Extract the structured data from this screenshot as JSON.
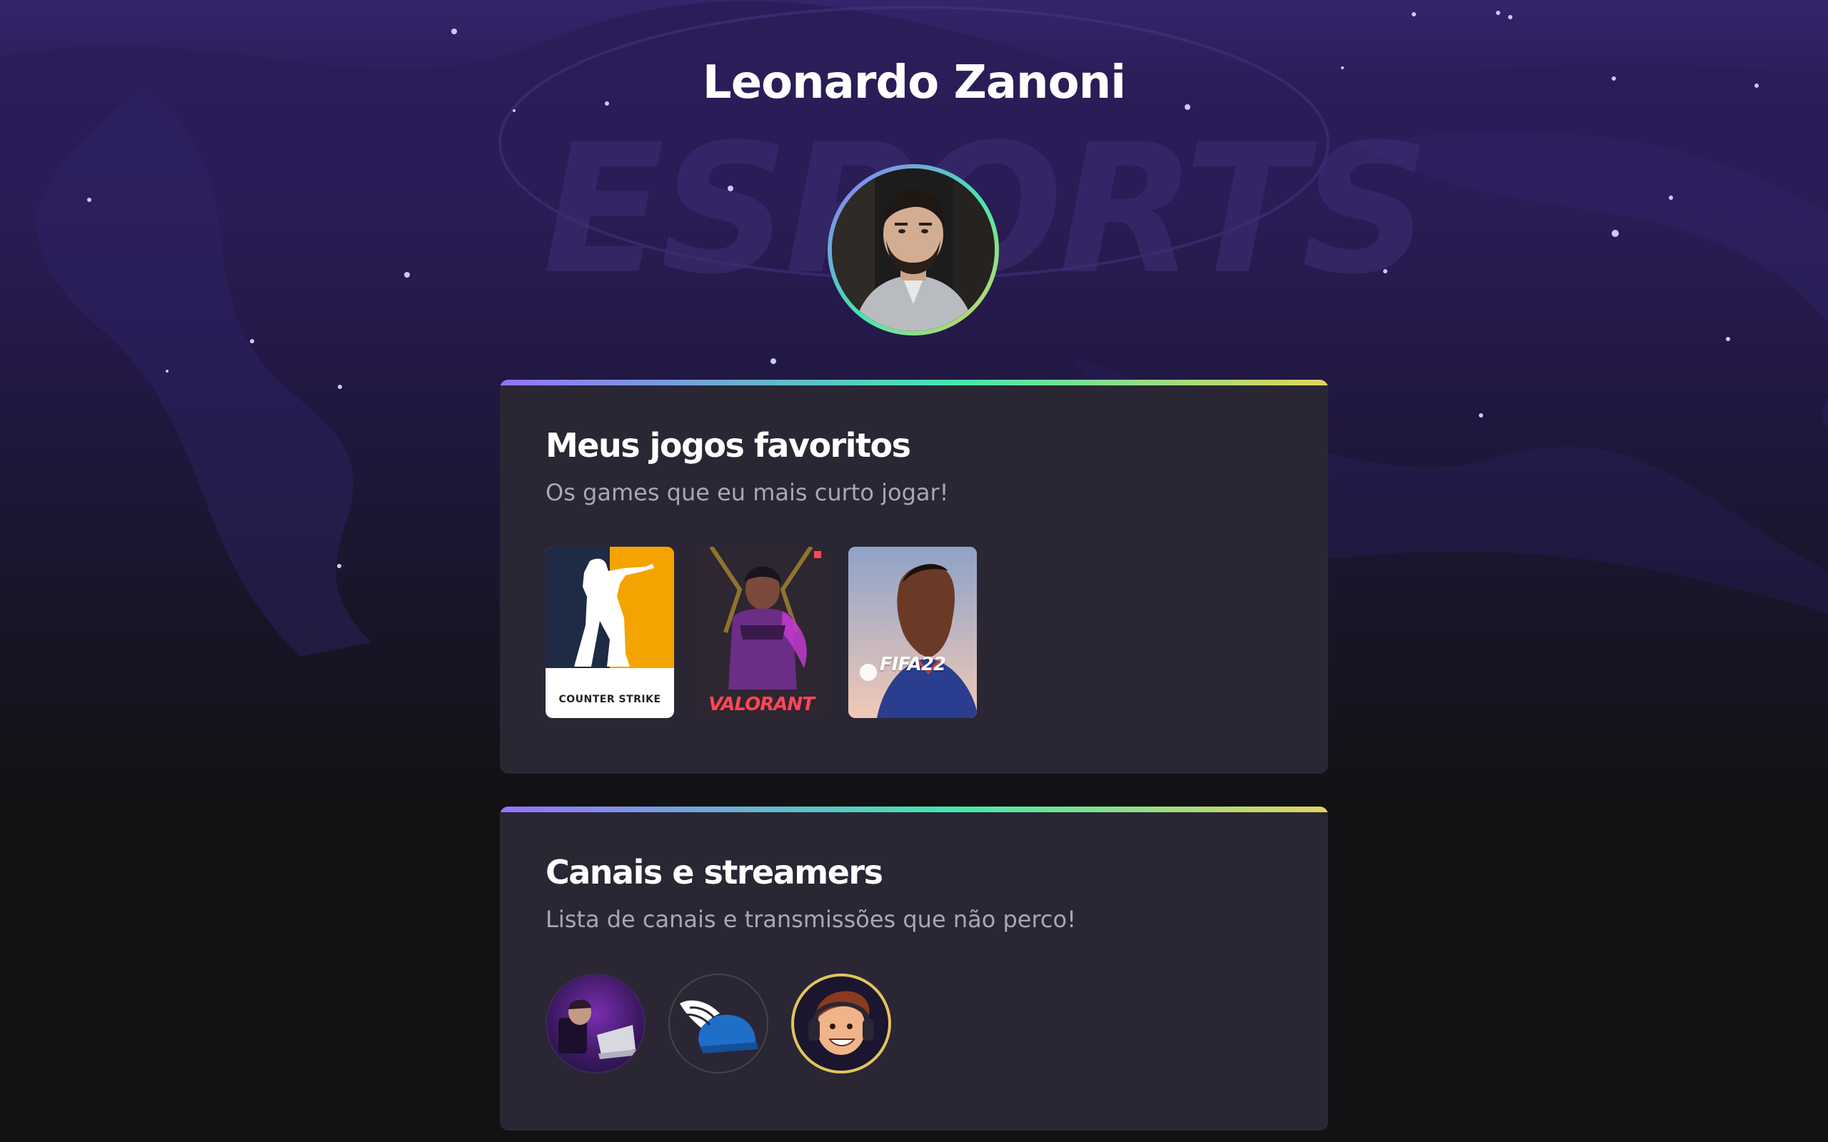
{
  "profile": {
    "name": "Leonardo Zanoni",
    "avatar_alt": "Leonardo Zanoni"
  },
  "games_section": {
    "title": "Meus jogos favoritos",
    "subtitle": "Os games que eu mais curto jogar!",
    "games": [
      {
        "name": "COUNTER STRIKE",
        "icon": "counter-strike-cover"
      },
      {
        "name": "VALORANT",
        "icon": "valorant-cover"
      },
      {
        "name": "FIFA22",
        "icon": "fifa22-cover"
      }
    ]
  },
  "streamers_section": {
    "title": "Canais e streamers",
    "subtitle": "Lista de canais e transmissões que não perco!",
    "streamers": [
      {
        "icon": "streamer-avatar"
      },
      {
        "icon": "winged-helmet-logo"
      },
      {
        "icon": "cartoon-streamer-avatar"
      }
    ]
  },
  "colors": {
    "gradient_start": "#9572fc",
    "gradient_mid": "#43e7ad",
    "gradient_end": "#e2d45c",
    "card_bg": "#2a2634",
    "subtitle_text": "#a8a8b3"
  }
}
